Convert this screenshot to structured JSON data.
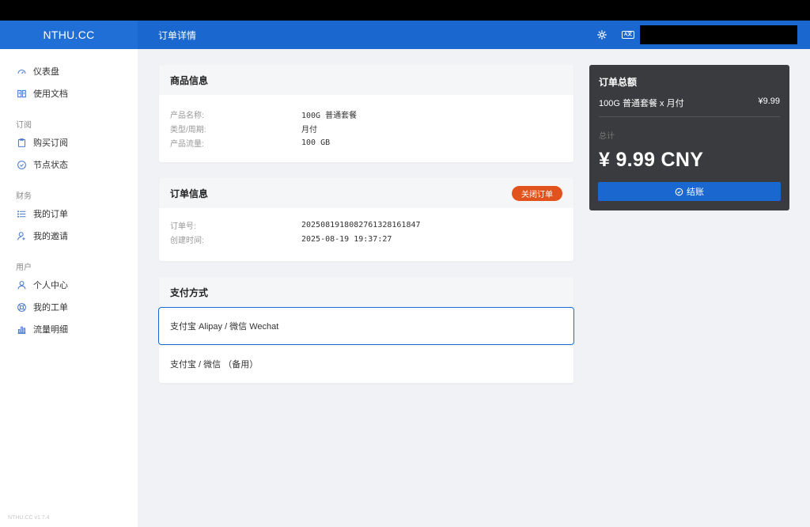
{
  "brand": "NTHU.CC",
  "version": "NTHU.CC v1.7.4",
  "header": {
    "title": "订单详情"
  },
  "sidebar": {
    "top_items": [
      {
        "label": "仪表盘",
        "icon": "dashboard-icon"
      },
      {
        "label": "使用文档",
        "icon": "book-icon"
      }
    ],
    "groups": [
      {
        "label": "订阅",
        "items": [
          {
            "label": "购买订阅",
            "icon": "clipboard-icon"
          },
          {
            "label": "节点状态",
            "icon": "check-circle-icon"
          }
        ]
      },
      {
        "label": "财务",
        "items": [
          {
            "label": "我的订单",
            "icon": "list-icon"
          },
          {
            "label": "我的邀请",
            "icon": "user-plus-icon"
          }
        ]
      },
      {
        "label": "用户",
        "items": [
          {
            "label": "个人中心",
            "icon": "user-icon"
          },
          {
            "label": "我的工单",
            "icon": "support-icon"
          },
          {
            "label": "流量明细",
            "icon": "bar-chart-icon"
          }
        ]
      }
    ]
  },
  "product": {
    "title": "商品信息",
    "rows": [
      {
        "k": "产品名称:",
        "v": "100G 普通套餐"
      },
      {
        "k": "类型/周期:",
        "v": "月付"
      },
      {
        "k": "产品流量:",
        "v": "100 GB"
      }
    ]
  },
  "order": {
    "title": "订单信息",
    "close_label": "关闭订单",
    "rows": [
      {
        "k": "订单号:",
        "v": "2025081918082761328161847"
      },
      {
        "k": "创建时间:",
        "v": "2025-08-19 19:37:27"
      }
    ]
  },
  "payment": {
    "title": "支付方式",
    "options": [
      {
        "label": "支付宝 Alipay / 微信 Wechat",
        "selected": true
      },
      {
        "label": "支付宝 / 微信 （备用）",
        "selected": false
      }
    ]
  },
  "summary": {
    "title": "订单总额",
    "item": "100G 普通套餐 x 月付",
    "price": "¥9.99",
    "total_label": "总计",
    "total": "¥ 9.99 CNY",
    "checkout_label": "结账"
  },
  "colors": {
    "primary": "#1b67d0",
    "danger": "#e2521d",
    "summary_bg": "#3a3b3e"
  }
}
